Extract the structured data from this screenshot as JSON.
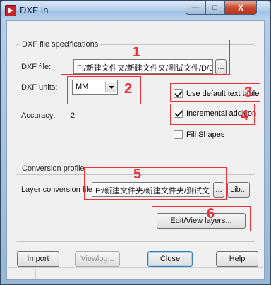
{
  "window": {
    "title": "DXF In"
  },
  "caption_buttons": {
    "minimize": "—",
    "maximize": "□",
    "close": "X"
  },
  "dxf_spec": {
    "legend": "DXF file specifications",
    "dxf_file_label": "DXF file:",
    "dxf_file_value": "F:/新建文件夹/新建文件夹/测试文件/D/D.dxf",
    "browse_label": "...",
    "units_label": "DXF units:",
    "units_value": "MM",
    "accuracy_label": "Accuracy:",
    "accuracy_value": "2",
    "use_default_text_table": {
      "label": "Use default text table",
      "checked": true
    },
    "incremental_addition": {
      "label": "Incremental addition",
      "checked": true
    },
    "fill_shapes": {
      "label": "Fill Shapes",
      "checked": false
    }
  },
  "conversion": {
    "legend": "Conversion profile",
    "layer_file_label": "Layer conversion file:",
    "layer_file_value": "F:/新建文件夹/新建文件夹/测试文件/D",
    "browse_label": "...",
    "lib_label": "Lib...",
    "edit_view_label": "Edit/View layers..."
  },
  "footer": {
    "import_label": "Import",
    "viewlog_label": "Viewlog...",
    "close_label": "Close",
    "help_label": "Help"
  },
  "callouts": [
    "1",
    "2",
    "3",
    "4",
    "5",
    "6"
  ],
  "colors": {
    "callout": "#e8313a",
    "dialog_bg": "#f0f0f0",
    "title_bar": "#b7d1ec"
  }
}
